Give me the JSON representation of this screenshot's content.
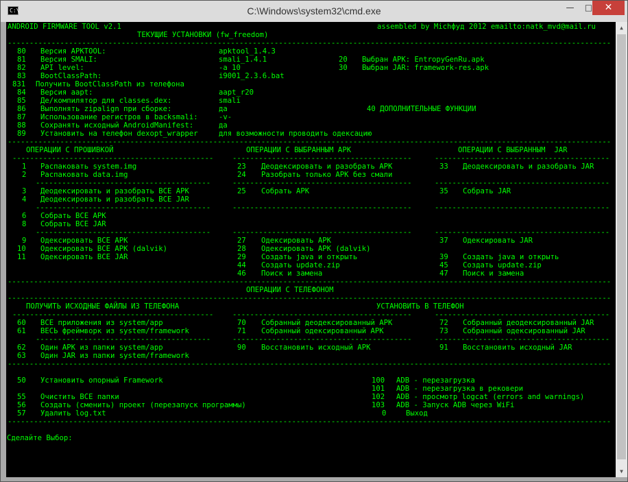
{
  "window": {
    "title": "C:\\Windows\\system32\\cmd.exe",
    "icon_label": "C:\\",
    "minimize_glyph": "—",
    "maximize_glyph": "□",
    "close_glyph": "✕"
  },
  "colors": {
    "console_bg": "#000000",
    "console_fg": "#00ff00",
    "close": "#c7403a"
  },
  "header": {
    "app_name": "ANDROID FIRMWARE TOOL v2.1",
    "credits": "assembled by Місhфуд 2012 emailto:natk_mvd@mail.ru",
    "settings_title": "ТЕКУЩИЕ УСТАНОВКИ (fw_freedom)"
  },
  "settings": [
    {
      "num": "80",
      "label": "Версия APKTOOL:",
      "value": "apktool_1.4.3"
    },
    {
      "num": "81",
      "label": "Версия SMALI:",
      "value": "smali_1.4.1"
    },
    {
      "num": "82",
      "label": "API level:",
      "value": "-a 10"
    },
    {
      "num": "83",
      "label": "BootClassPath:",
      "value": "i9001_2.3.6.bat"
    },
    {
      "num": "831",
      "label": "Получить BootClassPath из телефона",
      "value": ""
    },
    {
      "num": "84",
      "label": "Версия aapt:",
      "value": "aapt_r20"
    },
    {
      "num": "85",
      "label": "Де/компилятор для classes.dex:",
      "value": "smali"
    },
    {
      "num": "86",
      "label": "Выполнять zipalign при сборке:",
      "value": "да"
    },
    {
      "num": "87",
      "label": "Использование регистров в backsmali:",
      "value": "-v-"
    },
    {
      "num": "88",
      "label": "Сохранять исходный AndroidManifest:",
      "value": "да"
    },
    {
      "num": "89",
      "label": "Установить на телефон dexopt_wrapper",
      "value": "для возможности проводить одексацию"
    }
  ],
  "selected": [
    {
      "num": "20",
      "text": "Выбран APK: EntropyGenRu.apk"
    },
    {
      "num": "30",
      "text": "Выбран JAR: framework-res.apk"
    }
  ],
  "extra_functions": "40 ДОПОЛНИТЕЛЬНЫЕ ФУНКЦИИ",
  "sections": {
    "firmware": "ОПЕРАЦИИ С ПРОШИВКОЙ",
    "apk": "ОПЕРАЦИИ С ВЫБРАННЫМ APK",
    "jar": "ОПЕРАЦИИ С ВЫБРАННЫМ  JAR",
    "phone": "ОПЕРАЦИИ С ТЕЛЕФОНОМ",
    "get_files": "ПОЛУЧИТЬ ИСХОДНЫЕ ФАЙЛЫ ИЗ ТЕЛЕФОНА",
    "install": "УСТАНОВИТЬ В ТЕЛЕФОН"
  },
  "firmware_ops": [
    {
      "num": "1",
      "text": "Распаковать system.img"
    },
    {
      "num": "2",
      "text": "Распаковать data.img"
    },
    {
      "num": "3",
      "text": "Деодексировать и разобрать ВСЕ APK"
    },
    {
      "num": "4",
      "text": "Деодексировать и разобрать ВСЕ JAR"
    },
    {
      "num": "6",
      "text": "Собрать ВСЕ APK"
    },
    {
      "num": "8",
      "text": "Собрать ВСЕ JAR"
    },
    {
      "num": "9",
      "text": "Одексировать ВСЕ APK"
    },
    {
      "num": "10",
      "text": "Одексировать ВСЕ APK (dalvik)"
    },
    {
      "num": "11",
      "text": "Одексировать ВСЕ JAR"
    }
  ],
  "apk_ops": [
    {
      "num": "23",
      "text": "Деодексировать и разобрать APK"
    },
    {
      "num": "24",
      "text": "Разобрать только APK без смали"
    },
    {
      "num": "25",
      "text": "Собрать APK"
    },
    {
      "num": "27",
      "text": "Одексировать APK"
    },
    {
      "num": "28",
      "text": "Одексировать APK (dalvik)"
    },
    {
      "num": "29",
      "text": "Создать java и открыть"
    },
    {
      "num": "44",
      "text": "Создать update.zip"
    },
    {
      "num": "46",
      "text": "Поиск и замена"
    }
  ],
  "jar_ops": [
    {
      "num": "33",
      "text": "Деодексировать и разобрать JAR"
    },
    {
      "num": "35",
      "text": "Собрать JAR"
    },
    {
      "num": "37",
      "text": "Одексировать JAR"
    },
    {
      "num": "39",
      "text": "Создать java и открыть"
    },
    {
      "num": "45",
      "text": "Создать update.zip"
    },
    {
      "num": "47",
      "text": "Поиск и замена"
    }
  ],
  "get_ops": [
    {
      "num": "60",
      "text": "ВСЕ приложения из system/app"
    },
    {
      "num": "61",
      "text": "ВЕСЬ фреймворк из system/framework"
    },
    {
      "num": "62",
      "text": "Один APK из папки system/app"
    },
    {
      "num": "63",
      "text": "Один JAR из папки system/framework"
    }
  ],
  "install_ops": [
    {
      "num": "70",
      "text": "Собранный деодексированный APK"
    },
    {
      "num": "71",
      "text": "Собранный одексированный APK"
    },
    {
      "num": "90",
      "text": "Восстановить исходный APK"
    },
    {
      "num": "72",
      "text": "Собранный деодексированный JAR"
    },
    {
      "num": "73",
      "text": "Собранный одексированный JAR"
    },
    {
      "num": "91",
      "text": "Восстановить исходный JAR"
    }
  ],
  "misc_ops": [
    {
      "num": "50",
      "text": "Установить опорный Framework"
    },
    {
      "num": "55",
      "text": "Очистить ВСЕ папки"
    },
    {
      "num": "56",
      "text": "Создать (сменить) проект (перезапуск программы)"
    },
    {
      "num": "57",
      "text": "Удалить log.txt"
    }
  ],
  "adb_ops": [
    {
      "num": "100",
      "text": "ADB - перезагрузка"
    },
    {
      "num": "101",
      "text": "ADB - перезагрузка в рековери"
    },
    {
      "num": "102",
      "text": "ADB - просмотр logcat (errors and warnings)"
    },
    {
      "num": "103",
      "text": "ADB - Запуск ADB через WiFi"
    },
    {
      "num": "0",
      "text": "Выход"
    }
  ],
  "prompt": "Сделайте Выбор:"
}
